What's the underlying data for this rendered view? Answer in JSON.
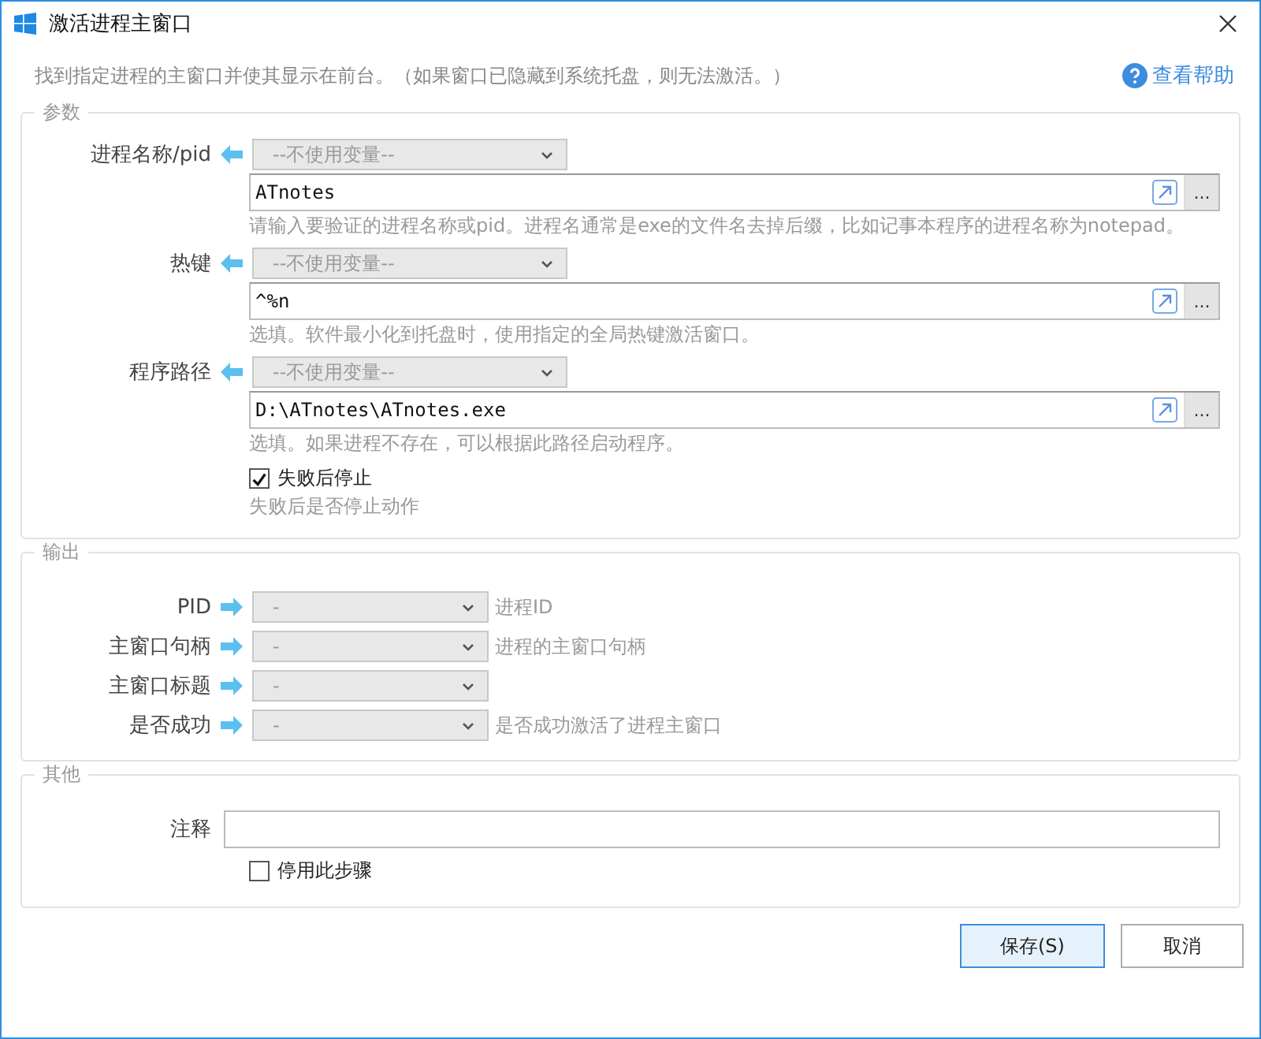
{
  "window": {
    "title": "激活进程主窗口"
  },
  "description": "找到指定进程的主窗口并使其显示在前台。（如果窗口已隐藏到系统托盘，则无法激活。）",
  "help_link": "查看帮助",
  "parameters": {
    "legend": "参数",
    "fields": [
      {
        "label": "进程名称/pid",
        "variable": "--不使用变量--",
        "value": "ATnotes",
        "browse": "...",
        "hint": "请输入要验证的进程名称或pid。进程名通常是exe的文件名去掉后缀，比如记事本程序的进程名称为notepad。"
      },
      {
        "label": "热键",
        "variable": "--不使用变量--",
        "value": "^%n",
        "browse": "...",
        "hint": "选填。软件最小化到托盘时，使用指定的全局热键激活窗口。"
      },
      {
        "label": "程序路径",
        "variable": "--不使用变量--",
        "value": "D:\\ATnotes\\ATnotes.exe",
        "browse": "...",
        "hint": "选填。如果进程不存在，可以根据此路径启动程序。"
      }
    ],
    "stop_on_failure": {
      "label": "失败后停止",
      "checked": true,
      "hint": "失败后是否停止动作"
    }
  },
  "output": {
    "legend": "输出",
    "rows": [
      {
        "label": "PID",
        "value": "-",
        "hint": "进程ID"
      },
      {
        "label": "主窗口句柄",
        "value": "-",
        "hint": "进程的主窗口句柄"
      },
      {
        "label": "主窗口标题",
        "value": "-"
      },
      {
        "label": "是否成功",
        "value": "-",
        "hint": "是否成功激活了进程主窗口"
      }
    ]
  },
  "other": {
    "legend": "其他",
    "note": {
      "label": "注释"
    },
    "disable_step": {
      "label": "停用此步骤",
      "checked": false
    }
  },
  "buttons": [
    {
      "label": "保存(S)",
      "default": true
    },
    {
      "label": "取消",
      "default": false
    }
  ]
}
